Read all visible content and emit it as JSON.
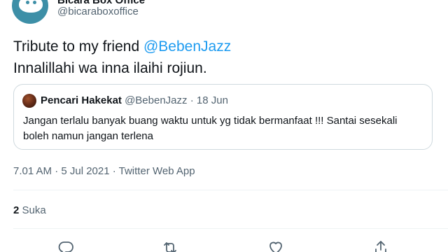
{
  "author": {
    "display_name": "Bicara Box Office",
    "handle": "@bicaraboxoffice"
  },
  "tweet": {
    "line1_prefix": "Tribute to my friend ",
    "line1_mention": "@BebenJazz",
    "line2": "Innalillahi wa inna ilaihi rojiun."
  },
  "quoted_tweet": {
    "name": "Pencari Hakekat",
    "handle": "@BebenJazz",
    "separator": "·",
    "date": "18 Jun",
    "text": "Jangan terlalu banyak buang waktu untuk yg tidak bermanfaat !!! Santai sesekali boleh namun jangan terlena"
  },
  "meta": {
    "timestamp": "7.01 AM · 5 Jul 2021 · Twitter Web App"
  },
  "stats": {
    "likes_count": "2",
    "likes_label": "Suka"
  },
  "actions": {
    "reply_icon": "reply-icon",
    "retweet_icon": "retweet-icon",
    "like_icon": "heart-icon",
    "share_icon": "share-icon"
  },
  "colors": {
    "accent": "#1d9bf0",
    "text_primary": "#0f1419",
    "text_secondary": "#536471",
    "border": "#cfd9de",
    "avatar_bg": "#3d8fa7"
  }
}
